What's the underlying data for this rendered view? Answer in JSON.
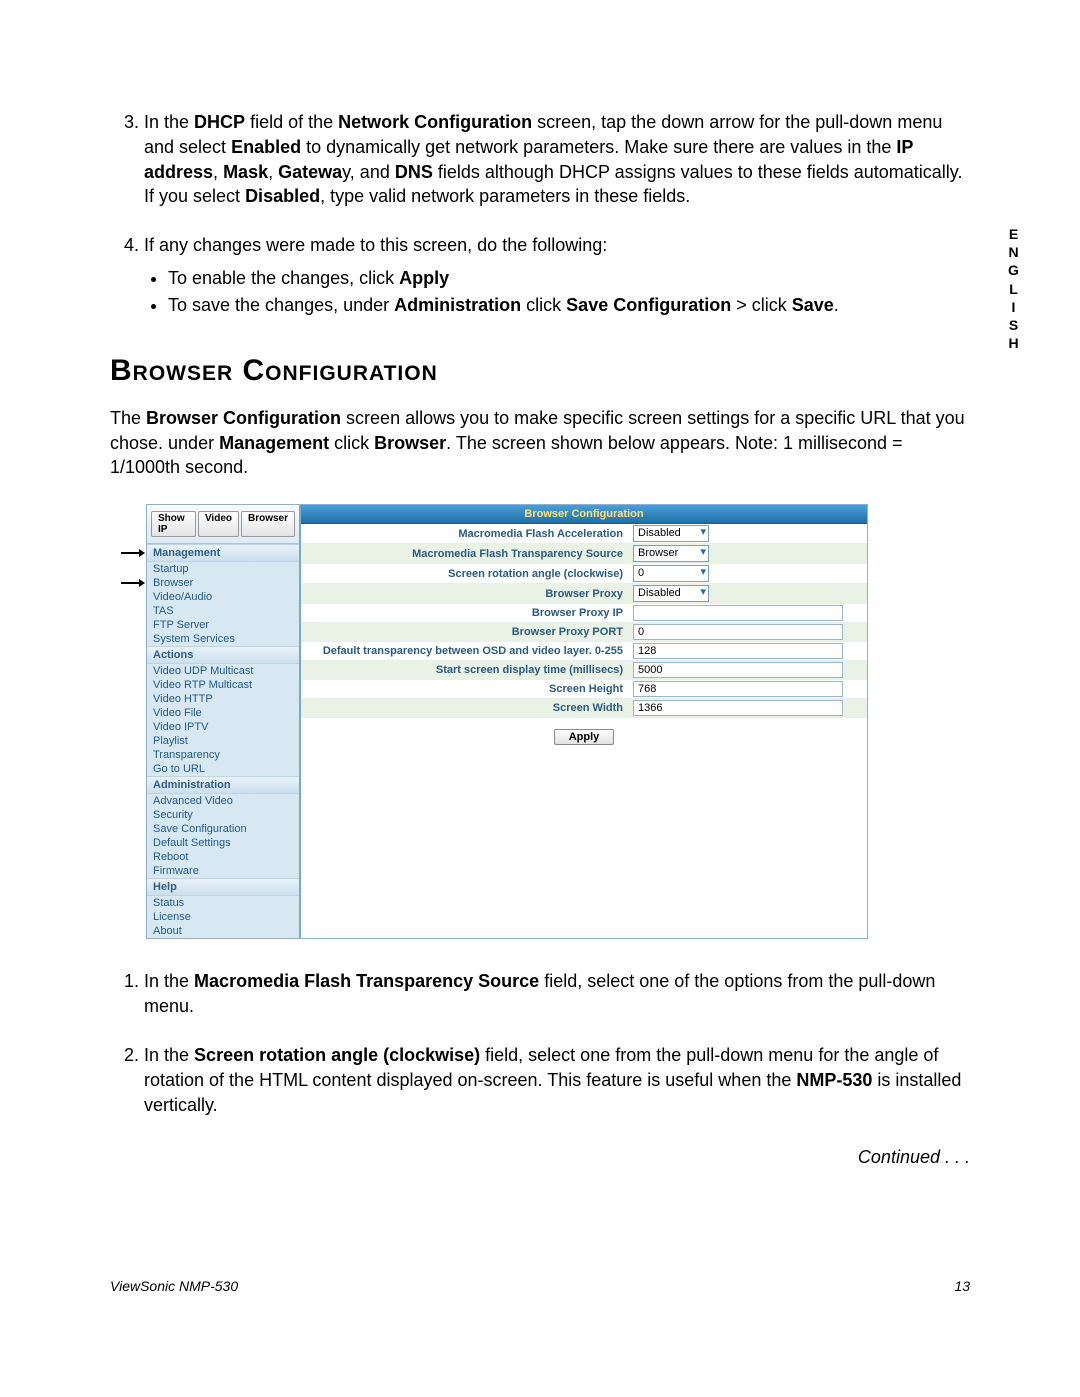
{
  "side_tab": [
    "E",
    "N",
    "G",
    "L",
    "I",
    "S",
    "H"
  ],
  "step3": {
    "prefix": "In the ",
    "b1": "DHCP",
    "t1": " field of the ",
    "b2": "Network Configuration",
    "t2": " screen, tap the down arrow for the pull-down menu and select ",
    "b3": "Enabled",
    "t3": " to dynamically get network parameters. Make sure there are values in the ",
    "b4": "IP address",
    "t4": ", ",
    "b5": "Mask",
    "t5": ", ",
    "b6": "Gatewa",
    "t6": "y, and ",
    "b7": "DNS",
    "t7": " fields although DHCP assigns values to these fields automatically. If you select ",
    "b8": "Disabled",
    "t8": ", type valid network parameters in these fields."
  },
  "step4": {
    "lead": "If any changes were made to this screen, do the following:",
    "bullet1_pre": "To enable the changes, click ",
    "bullet1_b": "Apply",
    "bullet2_pre": "To save the changes, under ",
    "bullet2_b1": "Administration",
    "bullet2_mid": " click ",
    "bullet2_b2": "Save Configuration",
    "bullet2_mid2": " > click ",
    "bullet2_b3": "Save",
    "bullet2_end": "."
  },
  "heading": "Browser Configuration",
  "intro": {
    "t1": "The ",
    "b1": "Browser Configuration",
    "t2": " screen allows you to make specific screen settings for a specific URL that you chose. under ",
    "b2": "Management",
    "t3": " click ",
    "b3": "Browser",
    "t4": ". The screen shown below appears. Note: 1 millisecond = 1/1000th second."
  },
  "shot": {
    "tabs": [
      "Show IP",
      "Video",
      "Browser"
    ],
    "groups": {
      "Management": [
        "Startup",
        "Browser",
        "Video/Audio",
        "TAS",
        "FTP Server",
        "System Services"
      ],
      "Actions": [
        "Video UDP Multicast",
        "Video RTP Multicast",
        "Video HTTP",
        "Video File",
        "Video IPTV",
        "Playlist",
        "Transparency",
        "Go to URL"
      ],
      "Administration": [
        "Advanced Video",
        "Security",
        "Save Configuration",
        "Default Settings",
        "Reboot",
        "Firmware"
      ],
      "Help": [
        "Status",
        "License",
        "About"
      ]
    },
    "title": "Browser Configuration",
    "rows": [
      {
        "label": "Macromedia Flash Acceleration",
        "type": "select",
        "value": "Disabled"
      },
      {
        "label": "Macromedia Flash Transparency Source",
        "type": "select",
        "value": "Browser"
      },
      {
        "label": "Screen rotation angle (clockwise)",
        "type": "select",
        "value": "0"
      },
      {
        "label": "Browser Proxy",
        "type": "select",
        "value": "Disabled"
      },
      {
        "label": "Browser Proxy IP",
        "type": "text",
        "value": ""
      },
      {
        "label": "Browser Proxy PORT",
        "type": "text",
        "value": "0"
      },
      {
        "label": "Default transparency between OSD and video layer. 0-255",
        "type": "text",
        "value": "128"
      },
      {
        "label": "Start screen display time (millisecs)",
        "type": "text",
        "value": "5000"
      },
      {
        "label": "Screen Height",
        "type": "text",
        "value": "768"
      },
      {
        "label": "Screen Width",
        "type": "text",
        "value": "1366"
      }
    ],
    "apply": "Apply"
  },
  "step_b1": {
    "t1": "In the ",
    "b1": "Macromedia Flash Transparency Source",
    "t2": " field, select one of the options from the pull-down menu."
  },
  "step_b2": {
    "t1": "In the ",
    "b1": "Screen rotation angle (clockwise)",
    "t2": " field, select one from the pull-down menu for the angle of rotation of the HTML content displayed on-screen. This feature is useful when the ",
    "b2": "NMP-530",
    "t3": " is installed vertically."
  },
  "continued": "Continued . . .",
  "footer_left": "ViewSonic NMP-530",
  "footer_right": "13"
}
